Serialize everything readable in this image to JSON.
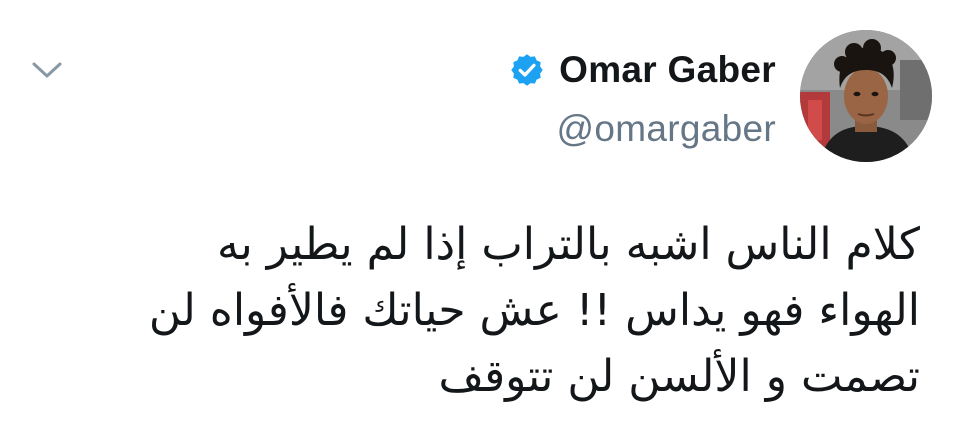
{
  "tweet": {
    "author": {
      "display_name": "Omar Gaber",
      "handle": "@omargaber",
      "verified": true
    },
    "text_lines": [
      "كلام الناس اشبه بالتراب إذا لم يطير به",
      "الهواء فهو يداس !! عش حياتك فالأفواه لن",
      "تصمت و الألسن لن تتوقف"
    ]
  },
  "icons": {
    "more": "chevron-down-icon",
    "verified": "verified-badge-icon"
  },
  "colors": {
    "verified_blue": "#1da1f2",
    "name_text": "#14171a",
    "handle_text": "#657786",
    "caret": "#8899a6"
  }
}
